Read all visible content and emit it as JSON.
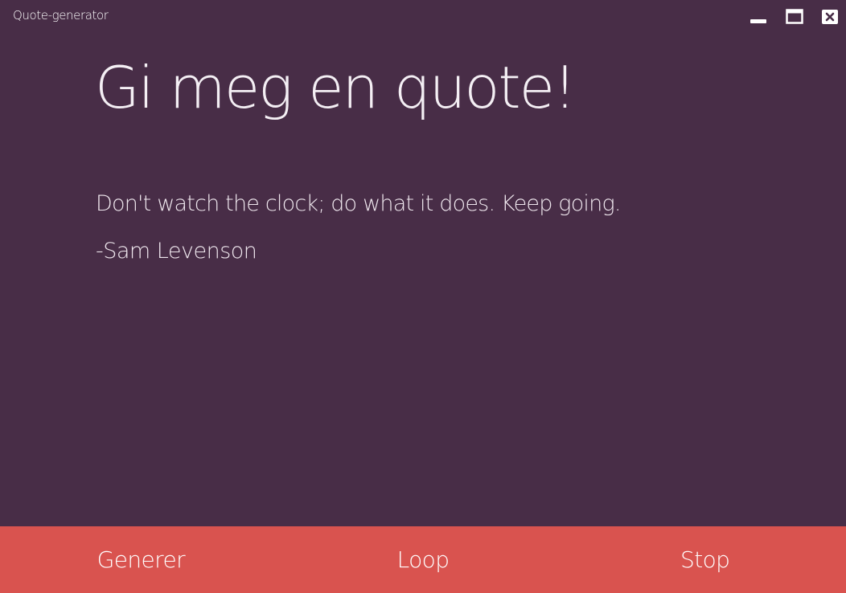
{
  "window": {
    "title": "Quote-generator",
    "controls": {
      "minimize_icon": "minimize-icon",
      "maximize_icon": "maximize-icon",
      "close_icon": "close-icon"
    }
  },
  "main": {
    "heading": "Gi meg en quote!",
    "quote": {
      "text": "Don't watch the clock; do what it does. Keep going.",
      "author": "-Sam Levenson"
    }
  },
  "actions": {
    "generate_label": "Generer",
    "loop_label": "Loop",
    "stop_label": "Stop"
  },
  "colors": {
    "background": "#482d47",
    "footer": "#d9534f",
    "text": "#f3eef2"
  }
}
